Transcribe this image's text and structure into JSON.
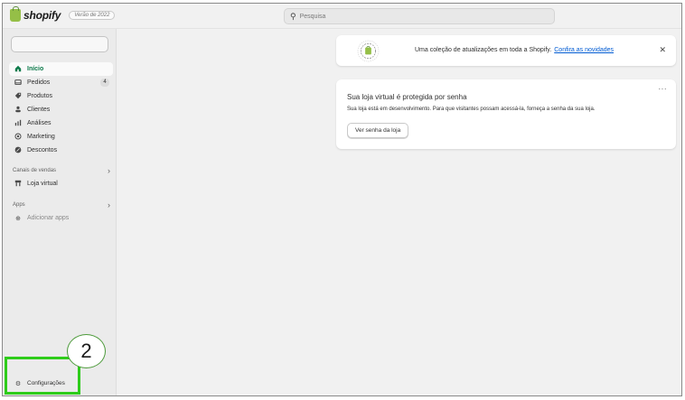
{
  "topbar": {
    "brand": "shopify",
    "edition_badge": "Verão de 2022",
    "search_placeholder": "Pesquisa"
  },
  "sidebar": {
    "nav": [
      {
        "label": "Início",
        "icon": "home-icon",
        "active": true
      },
      {
        "label": "Pedidos",
        "icon": "orders-icon",
        "badge": "4"
      },
      {
        "label": "Produtos",
        "icon": "tag-icon"
      },
      {
        "label": "Clientes",
        "icon": "person-icon"
      },
      {
        "label": "Análises",
        "icon": "bar-chart-icon"
      },
      {
        "label": "Marketing",
        "icon": "target-icon"
      },
      {
        "label": "Descontos",
        "icon": "discount-icon"
      }
    ],
    "sales_channels": {
      "heading": "Canais de vendas",
      "item": "Loja virtual"
    },
    "apps": {
      "heading": "Apps",
      "item": "Adicionar apps"
    },
    "settings_label": "Configurações"
  },
  "banner": {
    "text": "Uma coleção de atualizações em toda a Shopify.",
    "link": "Confira as novidades",
    "seal_text": "EDITIONS · SUMMER '22 · EDITIONS"
  },
  "password_card": {
    "title": "Sua loja virtual é protegida por senha",
    "description": "Sua loja está em desenvolvimento. Para que visitantes possam acessá-la, forneça a senha da sua loja.",
    "button": "Ver senha da loja",
    "menu": "···"
  },
  "annotation": {
    "step_number": "2",
    "highlight_color": "#2ecc1a"
  }
}
